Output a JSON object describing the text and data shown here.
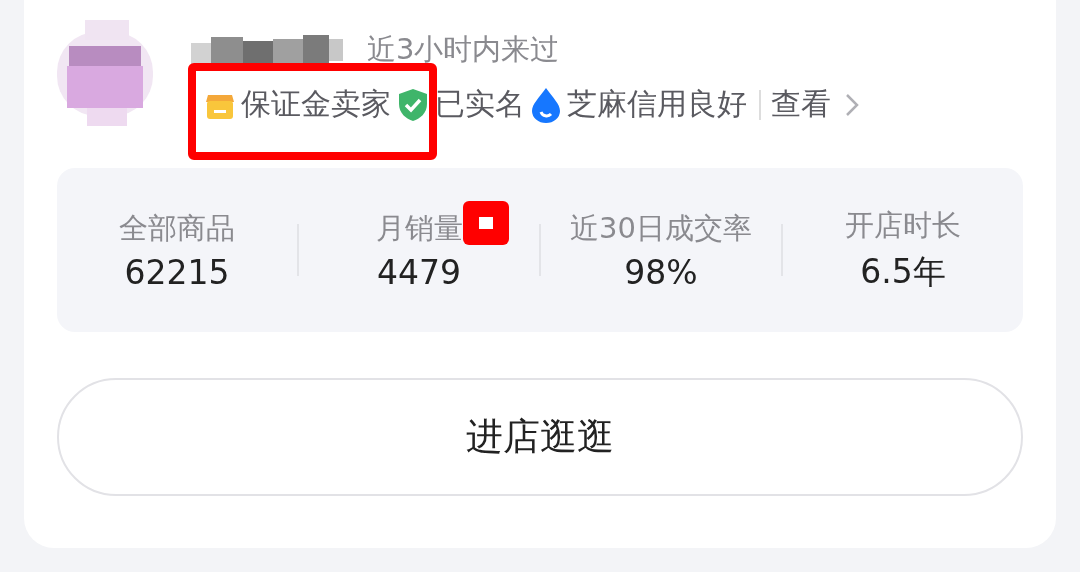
{
  "seller": {
    "last_seen": "近3小时内来过",
    "badges": [
      {
        "kind": "deposit",
        "label": "保证金卖家"
      },
      {
        "kind": "verified",
        "label": "已实名"
      },
      {
        "kind": "credit",
        "label": "芝麻信用良好"
      }
    ],
    "view_link": "查看"
  },
  "stats": [
    {
      "label": "全部商品",
      "value": "62215"
    },
    {
      "label": "月销量",
      "value": "4479"
    },
    {
      "label": "近30日成交率",
      "value": "98%"
    },
    {
      "label": "开店时长",
      "value": "6.5年"
    }
  ],
  "enter_button": "进店逛逛"
}
